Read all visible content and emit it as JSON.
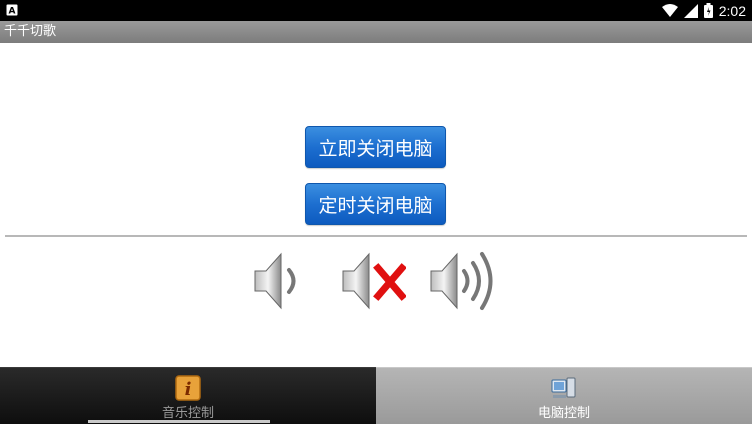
{
  "status_bar": {
    "time": "2:02"
  },
  "app": {
    "title": "千千切歌"
  },
  "actions": {
    "shutdown_now_label": "立即关闭电脑",
    "timed_shutdown_label": "定时关闭电脑"
  },
  "volume": {
    "down_icon": "speaker-low-icon",
    "mute_icon": "speaker-mute-icon",
    "up_icon": "speaker-high-icon"
  },
  "tabs": [
    {
      "label": "音乐控制",
      "icon": "info-icon",
      "selected": false
    },
    {
      "label": "电脑控制",
      "icon": "computer-icon",
      "selected": true
    }
  ],
  "colors": {
    "button_blue": "#1d6fd0",
    "mute_red": "#e01010",
    "title_bar": "#8a8a8a"
  }
}
